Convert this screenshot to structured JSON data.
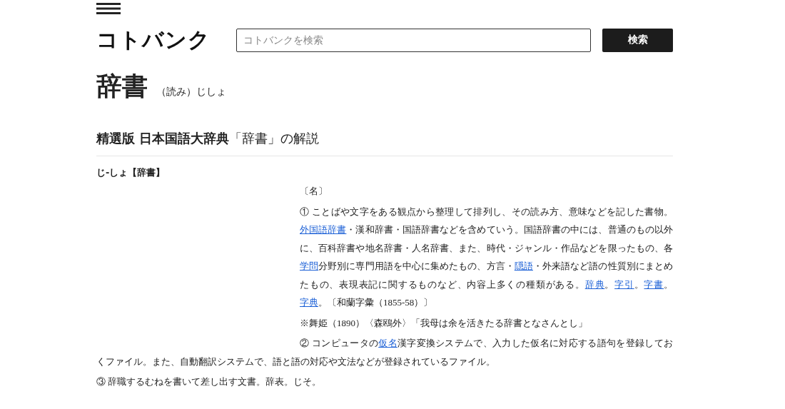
{
  "header": {
    "logo": "コトバンク",
    "search": {
      "placeholder": "コトバンクを検索"
    },
    "search_button": "検索"
  },
  "entry": {
    "title": "辞書",
    "reading": "（読み）じしょ"
  },
  "section": {
    "source": "精選版 日本国語大辞典",
    "heading_suffix": "「辞書」の解説",
    "headword": "じ-しょ【辞書】",
    "paragraphs": [
      {
        "segments": [
          {
            "kind": "text",
            "text": "〔名〕"
          }
        ]
      },
      {
        "segments": [
          {
            "kind": "text",
            "text": "① ことばや文字をある観点から整理して排列し、その読み方、意味などを記した書物。"
          },
          {
            "kind": "link",
            "text": "外国語辞書"
          },
          {
            "kind": "text",
            "text": "・漢和辞書・国語辞書などを含めていう。国語辞書の中には、普通のもの以外に、百科辞書や地名辞書・人名辞書、また、時代・ジャンル・作品などを限ったもの、各"
          },
          {
            "kind": "link",
            "text": "学問"
          },
          {
            "kind": "text",
            "text": "分野別に専門用語を中心に集めたもの、方言・"
          },
          {
            "kind": "link",
            "text": "隠語"
          },
          {
            "kind": "text",
            "text": "・外来語など語の性質別にまとめたもの、表現表記に関するものなど、内容上多くの種類がある。"
          },
          {
            "kind": "link",
            "text": "辞典"
          },
          {
            "kind": "text",
            "text": "。"
          },
          {
            "kind": "link",
            "text": "字引"
          },
          {
            "kind": "text",
            "text": "。"
          },
          {
            "kind": "link",
            "text": "字書"
          },
          {
            "kind": "text",
            "text": "。"
          },
          {
            "kind": "link",
            "text": "字典"
          },
          {
            "kind": "text",
            "text": "。〔和蘭字彙（1855-58）〕"
          }
        ]
      },
      {
        "segments": [
          {
            "kind": "text",
            "text": "※舞姫（1890）〈森鴎外〉「我母は余を活きたる辞書となさんとし」"
          }
        ]
      },
      {
        "segments": [
          {
            "kind": "text",
            "text": "② コンピュータの"
          },
          {
            "kind": "link",
            "text": "仮名"
          },
          {
            "kind": "text",
            "text": "漢字変換システムで、入力した仮名に対応する語句を登録しておくファイル。また、自動翻訳システムで、語と語の対応や文法などが登録されているファイル。"
          }
        ]
      },
      {
        "segments": [
          {
            "kind": "text",
            "text": "③ 辞職するむねを書いて差し出す文書。辞表。じそ。"
          }
        ]
      }
    ]
  }
}
